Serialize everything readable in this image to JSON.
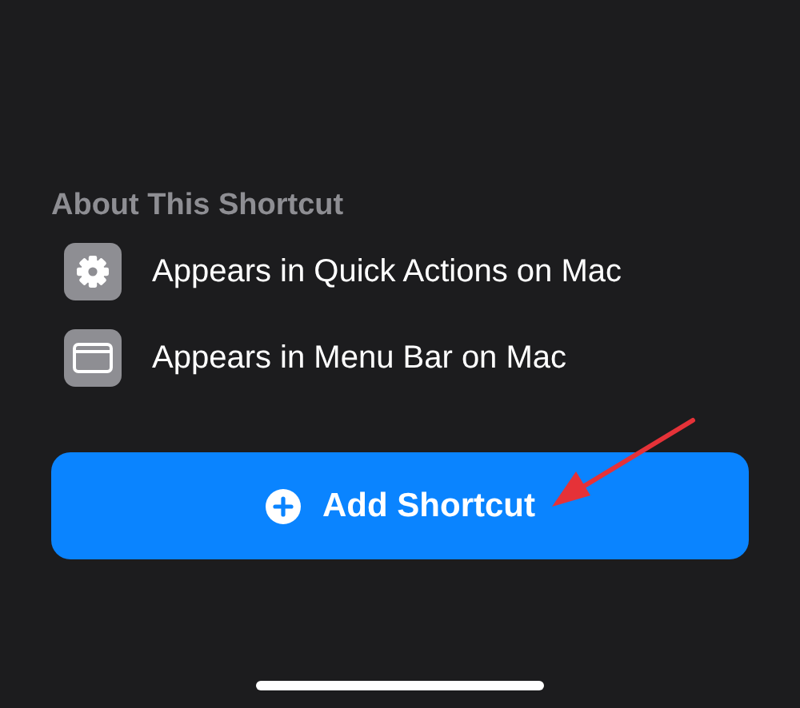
{
  "section": {
    "title": "About This Shortcut"
  },
  "items": [
    {
      "kind": "gear",
      "label": "Appears in Quick Actions on Mac"
    },
    {
      "kind": "window",
      "label": "Appears in Menu Bar on Mac"
    }
  ],
  "button": {
    "label": "Add Shortcut"
  }
}
